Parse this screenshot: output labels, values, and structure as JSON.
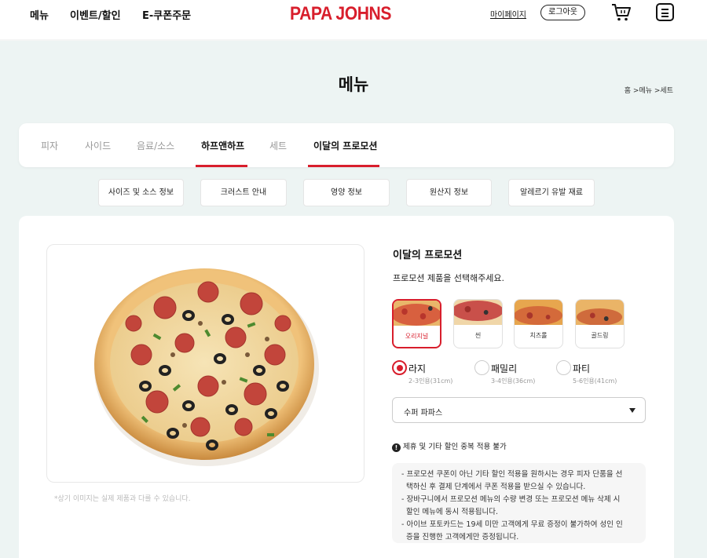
{
  "header": {
    "nav": [
      "메뉴",
      "이벤트/할인",
      "E-쿠폰주문"
    ],
    "logo": "PAPA JOHNS",
    "mypage": "마이페이지",
    "logout": "로그아웃",
    "brand_color": "#d81e2c"
  },
  "page": {
    "title": "메뉴",
    "breadcrumb": "홈 >메뉴 >세트"
  },
  "tabs": [
    {
      "label": "피자",
      "active": false
    },
    {
      "label": "사이드",
      "active": false
    },
    {
      "label": "음료/소스",
      "active": false
    },
    {
      "label": "하프앤하프",
      "active": true
    },
    {
      "label": "세트",
      "active": false
    },
    {
      "label": "이달의 프로모션",
      "active": true
    }
  ],
  "info_buttons": [
    "사이즈 및 소스 정보",
    "크러스트 안내",
    "영양 정보",
    "원산지 정보",
    "알레르기 유발 재료"
  ],
  "product": {
    "image_caption": "*상기 이미지는 실제 제품과 다를 수 있습니다.",
    "promo_title": "이달의 프로모션",
    "promo_sub": "프로모션 제품을 선택해주세요.",
    "crusts": [
      {
        "label": "오리지널",
        "selected": true
      },
      {
        "label": "씬",
        "selected": false
      },
      {
        "label": "치즈롤",
        "selected": false
      },
      {
        "label": "골드링",
        "selected": false
      }
    ],
    "sizes": [
      {
        "name": "라지",
        "desc": "2-3인용(31cm)",
        "selected": true
      },
      {
        "name": "패밀리",
        "desc": "3-4인용(36cm)",
        "selected": false
      },
      {
        "name": "파티",
        "desc": "5-6인용(41cm)",
        "selected": false
      }
    ],
    "selected_pizza": "수퍼 파파스",
    "notice": "제휴 및 기타 할인 중복 적용 불가",
    "terms": [
      "- 프로모션 쿠폰이 아닌 기타 할인 적용을 원하시는 경우 피자 단품을 선",
      "  택하신 후 결제 단계에서 쿠폰 적용을 받으실 수 있습니다.",
      "- 장바구니에서 프로모션 메뉴의 수량 변경 또는 프로모션 메뉴 삭제 시",
      "  할인 메뉴에 동시 적용됩니다.",
      "- 아이브 포토카드는 19세 미만 고객에게 무료 증정이 불가하여 성인 인",
      "  증을 진행한 고객에게만 증정됩니다."
    ]
  }
}
